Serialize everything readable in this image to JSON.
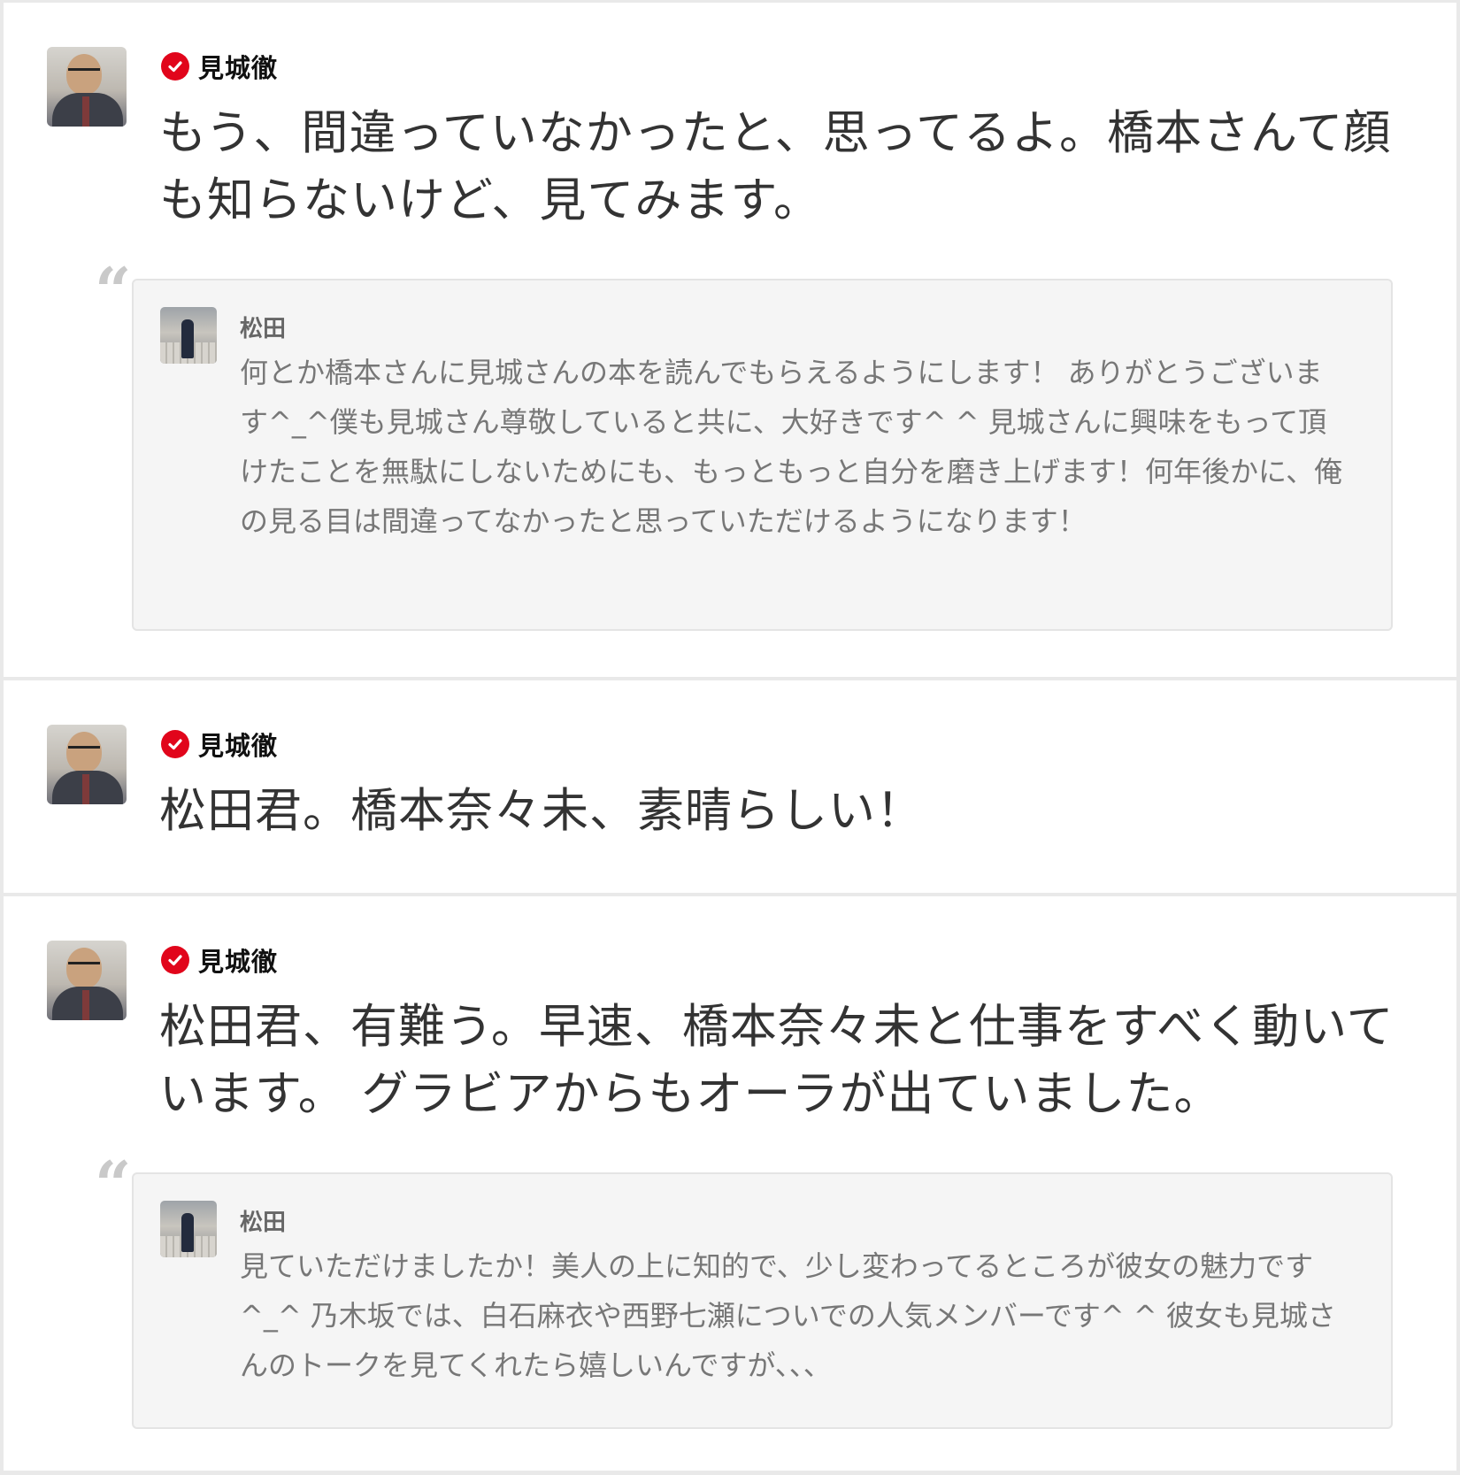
{
  "posts": [
    {
      "author": "見城徹",
      "text": "もう、間違っていなかったと、思ってるよ。橋本さんて顔も知らないけど、見てみます。",
      "quote": {
        "author": "松田",
        "text": "何とか橋本さんに見城さんの本を読んでもらえるようにします！ ありがとうございます^_^僕も見城さん尊敬していると共に、大好きです^ ^ 見城さんに興味をもって頂けたことを無駄にしないためにも、もっともっと自分を磨き上げます！何年後かに、俺の見る目は間違ってなかったと思っていただけるようになります！"
      }
    },
    {
      "author": "見城徹",
      "text": "松田君。橋本奈々未、素晴らしい！"
    },
    {
      "author": "見城徹",
      "text": "松田君、有難う。早速、橋本奈々未と仕事をすべく動いています。 グラビアからもオーラが出ていました。",
      "quote": {
        "author": "松田",
        "text": "見ていただけましたか！美人の上に知的で、少し変わってるところが彼女の魅力です^_^ 乃木坂では、白石麻衣や西野七瀬についでの人気メンバーです^ ^ 彼女も見城さんのトークを見てくれたら嬉しいんですが、、、"
      }
    }
  ],
  "icons": {
    "verified": "verified-check-icon",
    "quote": "quote-mark-icon"
  },
  "colors": {
    "verified_badge": "#e1051b",
    "quote_bg": "#f5f5f5",
    "page_bg": "#e9e9e9"
  }
}
